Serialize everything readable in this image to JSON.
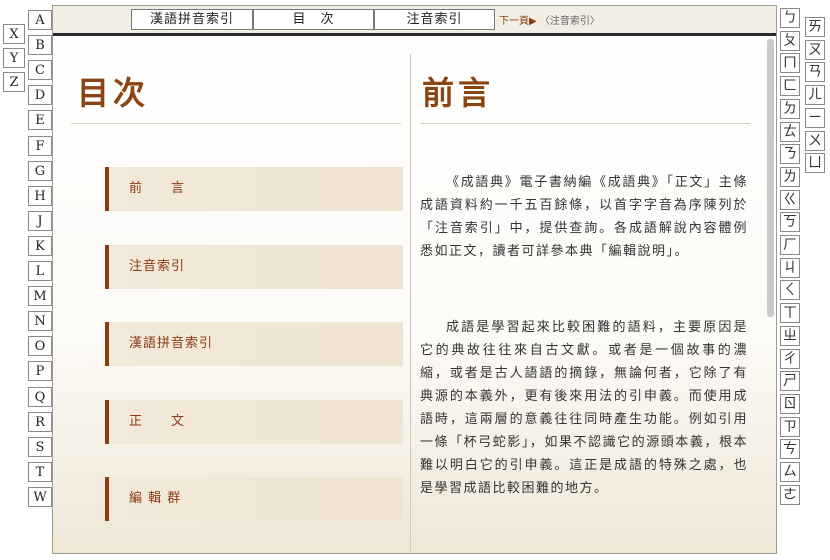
{
  "left_tabs": [
    "A",
    "B",
    "C",
    "D",
    "E",
    "F",
    "G",
    "H",
    "J",
    "K",
    "L",
    "M",
    "N",
    "O",
    "P",
    "Q",
    "R",
    "S",
    "T",
    "W"
  ],
  "left_tabs_extra": [
    "X",
    "Y",
    "Z"
  ],
  "right_tabs_col1": [
    "ㄅ",
    "ㄆ",
    "ㄇ",
    "ㄈ",
    "ㄉ",
    "ㄊ",
    "ㄋ",
    "ㄌ",
    "ㄍ",
    "ㄎ",
    "ㄏ",
    "ㄐ",
    "ㄑ",
    "ㄒ",
    "ㄓ",
    "ㄔ",
    "ㄕ",
    "ㄖ",
    "ㄗ",
    "ㄘ",
    "ㄙ",
    "ㄜ"
  ],
  "right_tabs_col2": [
    "ㄞ",
    "ㄡ",
    "ㄢ",
    "ㄦ",
    "ㄧ",
    "ㄨ",
    "ㄩ"
  ],
  "topbar": {
    "pinyin_index": "漢語拼音索引",
    "contents": "目　次",
    "zhuyin_index": "注音索引",
    "next_label": "下一頁▶",
    "next_target": "〈注音索引〉"
  },
  "left_page": {
    "title": "目次",
    "menu": [
      "前　　言",
      "注音索引",
      "漢語拼音索引",
      "正　　文",
      "編 輯 群"
    ]
  },
  "right_page": {
    "title": "前言",
    "paragraphs": [
      "《成語典》電子書納編《成語典》「正文」主條成語資料約一千五百餘條，以首字字音為序陳列於「注音索引」中，提供查詢。各成語解說內容體例悉如正文，讀者可詳參本典「編輯說明」。",
      "成語是學習起來比較困難的語料，主要原因是它的典故往往來自古文獻。或者是一個故事的濃縮，或者是古人語語的摘錄，無論何者，它除了有典源的本義外，更有後來用法的引申義。而使用成語時，這兩層的意義往往同時產生功能。例如引用一條「杯弓蛇影」，如果不認識它的源頭本義，根本難以明白它的引申義。這正是成語的特殊之處，也是學習成語比較困難的地方。"
    ]
  },
  "colors": {
    "accent": "#8b3a12",
    "title": "#8b4513"
  }
}
